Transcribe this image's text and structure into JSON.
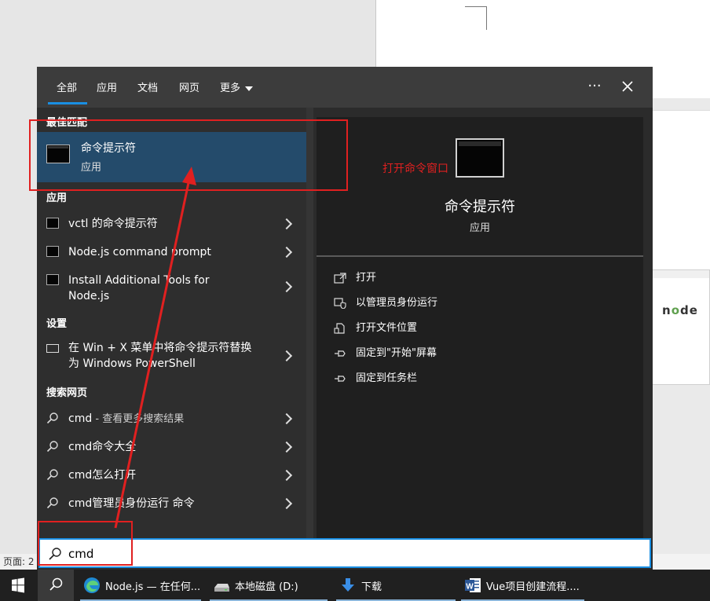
{
  "tabs": [
    {
      "label": "全部"
    },
    {
      "label": "应用"
    },
    {
      "label": "文档"
    },
    {
      "label": "网页"
    },
    {
      "label": "更多"
    }
  ],
  "topbar": {
    "more_options_icon": "ellipsis-icon",
    "close_icon": "close-icon"
  },
  "left": {
    "best_match_header": "最佳匹配",
    "best_match": {
      "title": "命令提示符",
      "subtitle": "应用"
    },
    "apps_header": "应用",
    "apps": [
      {
        "label": "vctl 的命令提示符"
      },
      {
        "label": "Node.js command prompt"
      },
      {
        "label": "Install Additional Tools for Node.js"
      }
    ],
    "settings_header": "设置",
    "settings": [
      {
        "label": "在 Win + X 菜单中将命令提示符替换为 Windows PowerShell"
      }
    ],
    "web_header": "搜索网页",
    "web": [
      {
        "label": "cmd",
        "suffix": " - 查看更多搜索结果"
      },
      {
        "label": "cmd命令大全",
        "suffix": ""
      },
      {
        "label": "cmd怎么打开",
        "suffix": ""
      },
      {
        "label": "cmd管理员身份运行 命令",
        "suffix": ""
      }
    ]
  },
  "detail": {
    "title": "命令提示符",
    "subtitle": "应用",
    "actions": [
      {
        "label": "打开",
        "icon": "open-icon"
      },
      {
        "label": "以管理员身份运行",
        "icon": "shield-icon"
      },
      {
        "label": "打开文件位置",
        "icon": "file-location-icon"
      },
      {
        "label": "固定到\"开始\"屏幕",
        "icon": "pin-icon"
      },
      {
        "label": "固定到任务栏",
        "icon": "pin-icon"
      }
    ]
  },
  "search": {
    "value": "cmd"
  },
  "annotation": {
    "label": "打开命令窗口",
    "color": "#e02020"
  },
  "background": {
    "page_label": "页面: 2"
  },
  "taskbar": {
    "apps": [
      {
        "label": "Node.js — 在任何...",
        "icon": "edge-icon"
      },
      {
        "label": "本地磁盘 (D:)",
        "icon": "drive-icon"
      },
      {
        "label": "下载",
        "icon": "download-icon"
      },
      {
        "label": "Vue项目创建流程....",
        "icon": "word-icon"
      }
    ]
  },
  "colors": {
    "accent": "#1a8fe3",
    "best_match_bg": "#244b6b",
    "panel_bg": "#2b2b2b"
  }
}
